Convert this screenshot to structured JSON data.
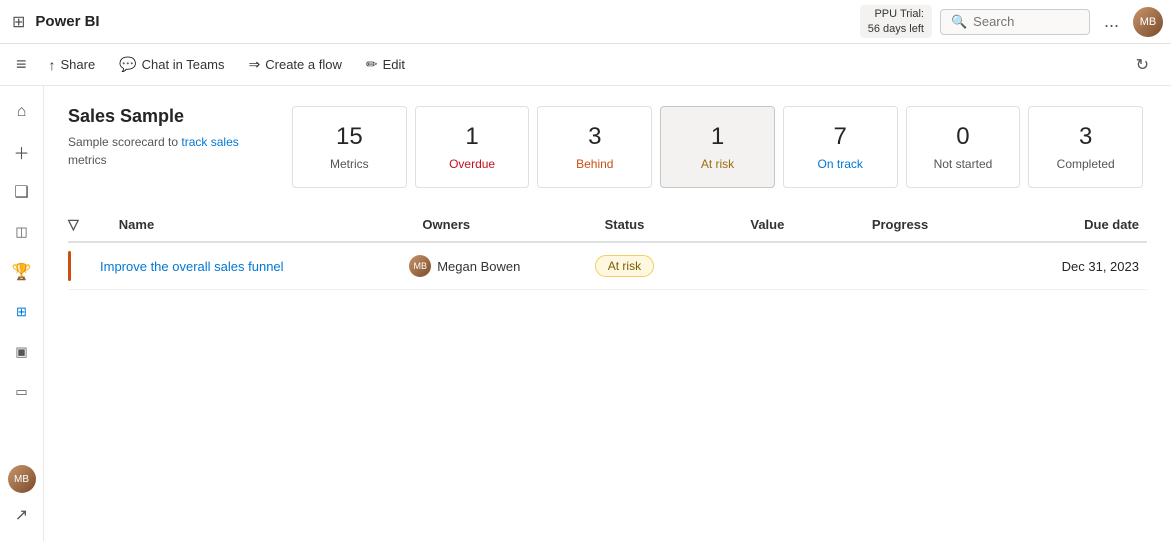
{
  "topbar": {
    "app_title": "Power BI",
    "trial_line1": "PPU Trial:",
    "trial_line2": "56 days left",
    "search_placeholder": "Search",
    "dots_label": "...",
    "avatar_initials": "MB"
  },
  "actionbar": {
    "share_label": "Share",
    "chat_teams_label": "Chat in Teams",
    "create_flow_label": "Create a flow",
    "edit_label": "Edit"
  },
  "sidebar": {
    "icons": [
      {
        "name": "home-icon",
        "symbol": "⌂"
      },
      {
        "name": "plus-icon",
        "symbol": "+"
      },
      {
        "name": "browse-icon",
        "symbol": "❑"
      },
      {
        "name": "data-icon",
        "symbol": "◫"
      },
      {
        "name": "trophy-icon",
        "symbol": "⬡"
      },
      {
        "name": "grid-icon",
        "symbol": "⊞"
      },
      {
        "name": "book-icon",
        "symbol": "▣"
      },
      {
        "name": "monitor-icon",
        "symbol": "▭"
      },
      {
        "name": "export-icon",
        "symbol": "↗"
      }
    ],
    "avatar_initials": "MB"
  },
  "scorecard": {
    "title": "Sales Sample",
    "description_text": "Sample scorecard to ",
    "description_link": "track sales",
    "description_end": " metrics"
  },
  "metrics": [
    {
      "number": "15",
      "label": "Metrics",
      "color": "gray",
      "selected": false
    },
    {
      "number": "1",
      "label": "Overdue",
      "color": "red",
      "selected": false
    },
    {
      "number": "3",
      "label": "Behind",
      "color": "orange",
      "selected": false
    },
    {
      "number": "1",
      "label": "At risk",
      "color": "yellow",
      "selected": true
    },
    {
      "number": "7",
      "label": "On track",
      "color": "blue",
      "selected": false
    },
    {
      "number": "0",
      "label": "Not started",
      "color": "gray",
      "selected": false
    },
    {
      "number": "3",
      "label": "Completed",
      "color": "gray",
      "selected": false
    }
  ],
  "table": {
    "columns": {
      "name": "Name",
      "owners": "Owners",
      "status": "Status",
      "value": "Value",
      "progress": "Progress",
      "due_date": "Due date"
    },
    "rows": [
      {
        "name": "Improve the overall sales funnel",
        "owner_name": "Megan Bowen",
        "owner_initials": "MB",
        "status": "At risk",
        "value": "",
        "progress": "",
        "due_date": "Dec 31, 2023"
      }
    ]
  }
}
